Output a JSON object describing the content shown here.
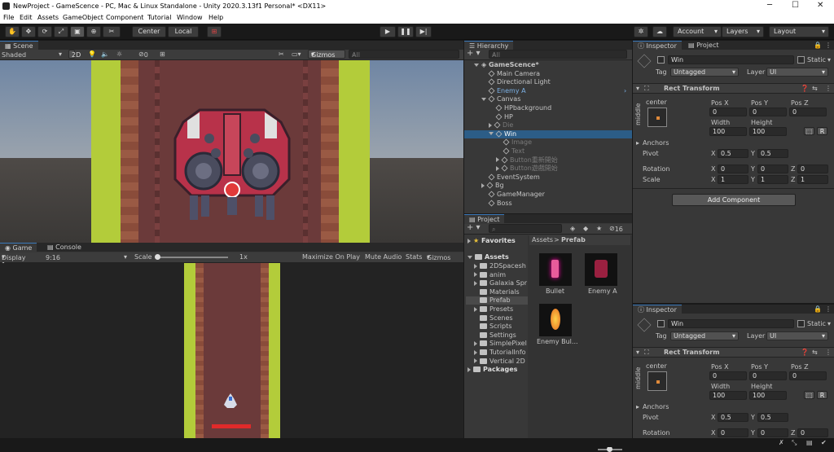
{
  "window": {
    "title": "NewProject - GameScence - PC, Mac & Linux Standalone - Unity 2020.3.13f1 Personal* <DX11>"
  },
  "menu": [
    "File",
    "Edit",
    "Assets",
    "GameObject",
    "Component",
    "Tutorial",
    "Window",
    "Help"
  ],
  "toolbar": {
    "center": "Center",
    "local": "Local",
    "account": "Account",
    "layers": "Layers",
    "layout": "Layout"
  },
  "scene": {
    "tab": "Scene",
    "shading": "Shaded",
    "mode2d": "2D",
    "hidden_count": "0",
    "gizmos": "Gizmos",
    "search_placeholder": "All"
  },
  "game": {
    "tab": "Game",
    "console_tab": "Console",
    "display": "Display 1",
    "aspect": "9:16",
    "scale_label": "Scale",
    "scale_value": "1x",
    "maximize": "Maximize On Play",
    "mute": "Mute Audio",
    "stats": "Stats",
    "gizmos": "Gizmos"
  },
  "hierarchy": {
    "tab": "Hierarchy",
    "search_placeholder": "All",
    "items": [
      {
        "label": "GameScence*",
        "depth": 0,
        "kind": "scene"
      },
      {
        "label": "Main Camera",
        "depth": 1
      },
      {
        "label": "Directional Light",
        "depth": 1
      },
      {
        "label": "Enemy A",
        "depth": 1,
        "kind": "prefab"
      },
      {
        "label": "Canvas",
        "depth": 1,
        "kind": "open"
      },
      {
        "label": "HPbackground",
        "depth": 2
      },
      {
        "label": "HP",
        "depth": 2
      },
      {
        "label": "Die",
        "depth": 2,
        "kind": "dim-closed"
      },
      {
        "label": "Win",
        "depth": 2,
        "kind": "selected"
      },
      {
        "label": "Image",
        "depth": 3,
        "kind": "dim"
      },
      {
        "label": "Text",
        "depth": 3,
        "kind": "dim"
      },
      {
        "label": "Button重新開始",
        "depth": 3,
        "kind": "dim-closed"
      },
      {
        "label": "Button遊戲開始",
        "depth": 3,
        "kind": "dim-closed"
      },
      {
        "label": "EventSystem",
        "depth": 1
      },
      {
        "label": "Bg",
        "depth": 1,
        "kind": "closed"
      },
      {
        "label": "GameManager",
        "depth": 1
      },
      {
        "label": "Boss",
        "depth": 1
      }
    ]
  },
  "project": {
    "tab": "Project",
    "hidden_count": "16",
    "favorites": "Favorites",
    "assets": "Assets",
    "folders": [
      "2DSpacesh",
      "anim",
      "Galaxia Spr",
      "Materials",
      "Prefab",
      "Presets",
      "Scenes",
      "Scripts",
      "Settings",
      "SimplePixel",
      "TutorialInfo",
      "Vertical 2D"
    ],
    "packages": "Packages",
    "breadcrumb": [
      "Assets",
      "Prefab"
    ],
    "items": [
      "Bullet",
      "Enemy A",
      "Enemy Bul..."
    ]
  },
  "inspectors": [
    {
      "tab_inspector": "Inspector",
      "tab_project": "Project",
      "name": "Win",
      "static": "Static",
      "tag_label": "Tag",
      "tag": "Untagged",
      "layer_label": "Layer",
      "layer": "UI",
      "component": "Rect Transform",
      "anchor_h": "center",
      "anchor_v": "middle",
      "pos_labels": [
        "Pos X",
        "Pos Y",
        "Pos Z"
      ],
      "pos": [
        "0",
        "0",
        "0"
      ],
      "size_labels": [
        "Width",
        "Height"
      ],
      "size": [
        "100",
        "100"
      ],
      "anchors": "Anchors",
      "pivot_label": "Pivot",
      "pivot": [
        "0.5",
        "0.5"
      ],
      "rotation_label": "Rotation",
      "rotation": [
        "0",
        "0",
        "0"
      ],
      "scale_label": "Scale",
      "scale": [
        "1",
        "1",
        "1"
      ],
      "add_component": "Add Component"
    },
    {
      "tab_inspector": "Inspector",
      "name": "Win",
      "static": "Static",
      "tag_label": "Tag",
      "tag": "Untagged",
      "layer_label": "Layer",
      "layer": "UI",
      "component": "Rect Transform",
      "anchor_h": "center",
      "anchor_v": "middle",
      "pos_labels": [
        "Pos X",
        "Pos Y",
        "Pos Z"
      ],
      "pos": [
        "0",
        "0",
        "0"
      ],
      "size_labels": [
        "Width",
        "Height"
      ],
      "size": [
        "100",
        "100"
      ],
      "anchors": "Anchors",
      "pivot_label": "Pivot",
      "pivot": [
        "0.5",
        "0.5"
      ],
      "rotation_label": "Rotation",
      "rotation": [
        "0",
        "0",
        "0"
      ]
    }
  ],
  "axis_letters": [
    "X",
    "Y",
    "Z"
  ],
  "colors": {
    "selection": "#2c5d87",
    "prefab_blue": "#7cb1e6",
    "accent": "#3a79bb"
  }
}
